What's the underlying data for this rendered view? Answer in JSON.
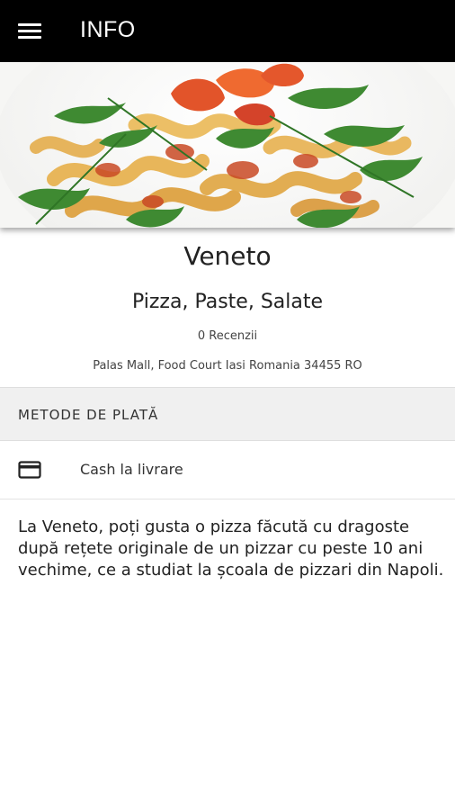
{
  "appbar": {
    "title": "INFO",
    "menu_icon": "menu-icon"
  },
  "restaurant": {
    "name": "Veneto",
    "cuisine": "Pizza, Paste, Salate",
    "reviews": "0 Recenzii",
    "address": "Palas Mall, Food Court Iasi Romania 34455 RO"
  },
  "payment": {
    "header": "METODE DE PLATĂ",
    "methods": [
      {
        "label": "Cash la livrare",
        "icon": "credit-card-icon"
      }
    ]
  },
  "description": "La Veneto, poți gusta o pizza făcută cu dragoste după rețete originale de un pizzar cu peste 10 ani vechime, ce a studiat la școala de pizzari din Napoli.",
  "colors": {
    "appbar": "#000000",
    "section_header_bg": "#f0f0f0"
  }
}
